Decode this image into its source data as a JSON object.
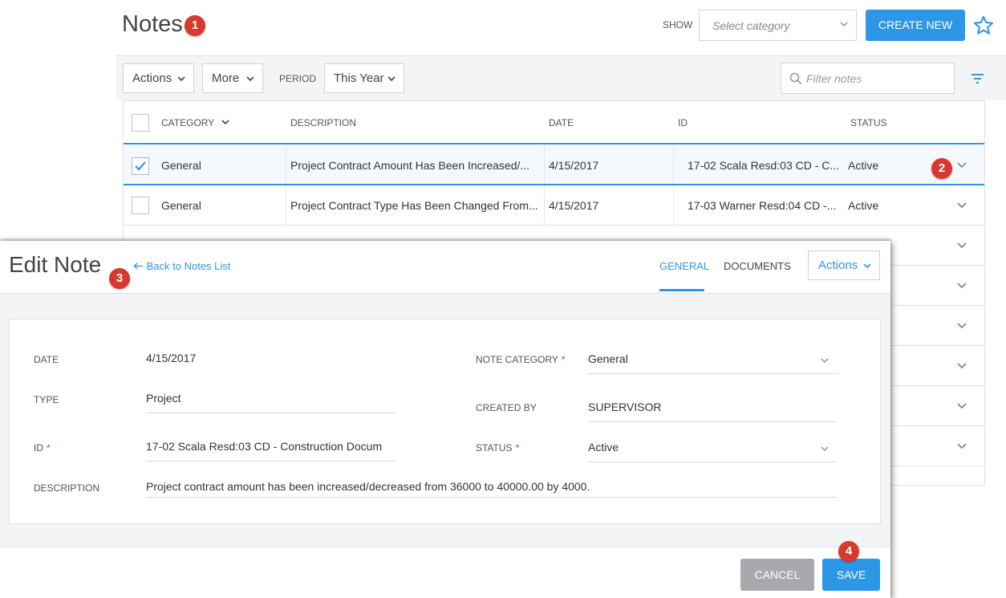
{
  "page": {
    "title": "Notes"
  },
  "header": {
    "show_label": "SHOW",
    "category_placeholder": "Select category",
    "create_label": "CREATE NEW"
  },
  "toolbar": {
    "actions_label": "Actions",
    "more_label": "More",
    "period_label": "PERIOD",
    "period_value": "This Year",
    "filter_placeholder": "Filter notes"
  },
  "grid": {
    "columns": [
      "CATEGORY",
      "DESCRIPTION",
      "DATE",
      "ID",
      "STATUS"
    ],
    "rows": [
      {
        "category": "General",
        "description": "Project Contract Amount Has Been Increased/...",
        "date": "4/15/2017",
        "id": "17-02 Scala Resd:03 CD - C...",
        "status": "Active",
        "checked": true
      },
      {
        "category": "General",
        "description": "Project Contract Type Has Been Changed From...",
        "date": "4/15/2017",
        "id": "17-03 Warner Resd:04 CD -...",
        "status": "Active",
        "checked": false
      }
    ]
  },
  "editor": {
    "title": "Edit Note",
    "back_label": "Back to Notes List",
    "tabs": [
      "GENERAL",
      "DOCUMENTS"
    ],
    "active_tab": "GENERAL",
    "actions_label": "Actions",
    "fields": {
      "date_label": "DATE",
      "date_value": "4/15/2017",
      "type_label": "TYPE",
      "type_value": "Project",
      "id_label": "ID",
      "id_value": "17-02 Scala Resd:03 CD - Construction Docum",
      "description_label": "DESCRIPTION",
      "description_value": "Project contract amount has been increased/decreased from 36000 to 40000.00 by 4000.",
      "category_label": "NOTE CATEGORY",
      "category_value": "General",
      "created_by_label": "CREATED BY",
      "created_by_value": "SUPERVISOR",
      "status_label": "STATUS",
      "status_value": "Active",
      "required_mark": "*"
    },
    "cancel_label": "CANCEL",
    "save_label": "SAVE"
  },
  "markers": [
    "1",
    "2",
    "3",
    "4"
  ],
  "colors": {
    "accent": "#2d97e6",
    "marker": "#d9382e",
    "cancel": "#a7a9ac"
  },
  "icons": [
    "chevron-down-icon",
    "star-icon",
    "search-icon",
    "filter-icon",
    "check-icon",
    "arrow-left-icon"
  ]
}
